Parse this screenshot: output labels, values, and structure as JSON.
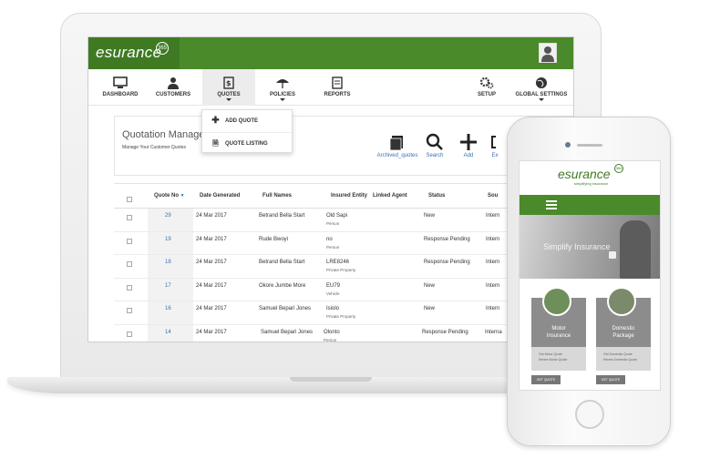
{
  "app": {
    "logo_text": "esurance",
    "logo_badge": "365"
  },
  "nav": {
    "items": [
      {
        "label": "DASHBOARD",
        "icon": "monitor-icon"
      },
      {
        "label": "CUSTOMERS",
        "icon": "user-icon"
      },
      {
        "label": "QUOTES",
        "icon": "quote-doc-icon",
        "active": true
      },
      {
        "label": "POLICIES",
        "icon": "umbrella-icon"
      },
      {
        "label": "REPORTS",
        "icon": "document-icon"
      },
      {
        "label": "SETUP",
        "icon": "gears-icon"
      },
      {
        "label": "GLOBAL SETTINGS",
        "icon": "globe-icon"
      }
    ]
  },
  "dropdown": {
    "items": [
      {
        "label": "ADD QUOTE",
        "icon": "plus-icon"
      },
      {
        "label": "QUOTE LISTING",
        "icon": "quote-doc-icon"
      }
    ]
  },
  "page": {
    "title": "Quotation Manager",
    "subtitle": "Manage Your Customer Quotes",
    "tools": [
      {
        "label": "Archived_quotes",
        "icon": "archive-icon"
      },
      {
        "label": "Search",
        "icon": "search-icon"
      },
      {
        "label": "Add",
        "icon": "plus-icon"
      },
      {
        "label": "Ex",
        "icon": "export-icon"
      }
    ]
  },
  "table": {
    "headers": [
      "Quote No",
      "Date Generated",
      "Full Names",
      "Insured Entity",
      "Linked Agent",
      "Status",
      "Sou"
    ],
    "rows": [
      {
        "quote_no": "29",
        "date": "24 Mar 2017",
        "name": "Betrand Bella Start",
        "entity": "Old Sapi",
        "entity_type": "Person",
        "status": "New",
        "source": "Intern"
      },
      {
        "quote_no": "19",
        "date": "24 Mar 2017",
        "name": "Rude Bwoyi",
        "entity": "no",
        "entity_type": "Person",
        "status": "Response Pending",
        "source": "Intern"
      },
      {
        "quote_no": "18",
        "date": "24 Mar 2017",
        "name": "Betrand Bella Start",
        "entity": "LRE8246",
        "entity_type": "Private Property",
        "status": "Response Pending",
        "source": "Intern"
      },
      {
        "quote_no": "17",
        "date": "24 Mar 2017",
        "name": "Okore Jumbe More",
        "entity": "EU79",
        "entity_type": "Vehicle",
        "status": "New",
        "source": "Intern"
      },
      {
        "quote_no": "16",
        "date": "24 Mar 2017",
        "name": "Samuel Bepari Jones",
        "entity": "Isiolo",
        "entity_type": "Private Property",
        "status": "New",
        "source": "Intern"
      },
      {
        "quote_no": "14",
        "date": "24 Mar 2017",
        "name": "Samuel Bepari Jones",
        "entity": "Olonto",
        "entity_type": "Person",
        "status": "Response Pending",
        "source": "Interna"
      }
    ]
  },
  "mobile": {
    "logo_text": "esurance",
    "logo_badge": "365",
    "tagline": "simplifying insurance",
    "hero_text": "Simplify Insurance",
    "cards": [
      {
        "title_line1": "Motor",
        "title_line2": "Insurance",
        "items": [
          "Get Motor Quote",
          "Renew Motor Quote"
        ],
        "button": "GET QUOTE"
      },
      {
        "title_line1": "Domestic",
        "title_line2": "Package",
        "items": [
          "Get Domestic Quote",
          "Renew Domestic Quote"
        ],
        "button": "GET QUOTE"
      }
    ]
  },
  "colors": {
    "brand_green": "#4a8a2a",
    "brand_green_dark": "#3f7a23",
    "link_blue": "#3a6fb0"
  }
}
